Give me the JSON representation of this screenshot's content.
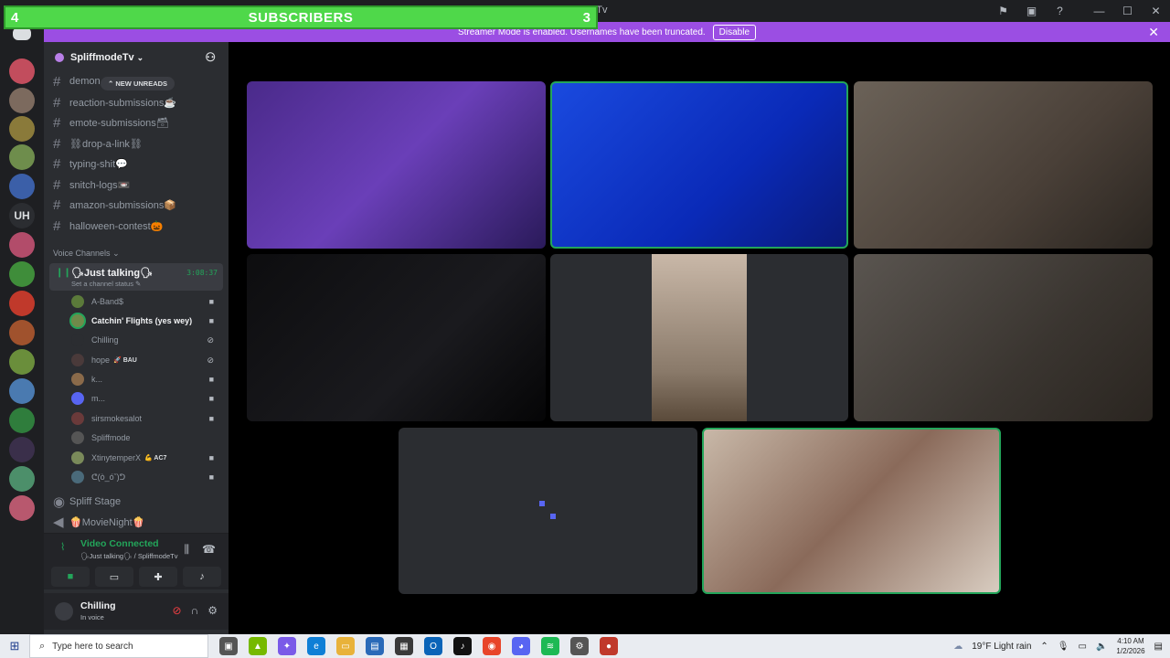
{
  "window": {
    "title": "deTv"
  },
  "overlay": {
    "left_count": "4",
    "label": "SUBSCRIBERS",
    "right_count": "3",
    "color": "#4fd84a"
  },
  "banner": {
    "text": "Streamer Mode is enabled. Usernames have been truncated.",
    "button": "Disable",
    "color": "#9b4ee3"
  },
  "rail": {
    "uh_label": "UH"
  },
  "server": {
    "name": "SpliffmodeTv"
  },
  "new_unreads": "NEW UNREADS",
  "channels": [
    {
      "name": "demon"
    },
    {
      "name": "reaction-submissions☕"
    },
    {
      "name": "emote-submissions🗃"
    },
    {
      "name": "⛓drop-a-link⛓"
    },
    {
      "name": "typing-shit💬"
    },
    {
      "name": "snitch-logs📼"
    },
    {
      "name": "amazon-submissions📦"
    },
    {
      "name": "halloween-contest🎃"
    }
  ],
  "voice_channels_header": "Voice Channels",
  "active_voice": {
    "name": "🗣Just talking🗣",
    "time": "3:08:37",
    "status": "Set a channel status ✎"
  },
  "members": [
    {
      "name": "A-Band$",
      "tag": "",
      "icon": "camera-icon"
    },
    {
      "name": "Catchin' Flights (yes wey)",
      "tag": "",
      "icon": "camera-icon"
    },
    {
      "name": "Chilling",
      "tag": "",
      "icon": "muted-icon"
    },
    {
      "name": "hope",
      "tag": "🚀 BAU",
      "icon": "deafened-icon"
    },
    {
      "name": "k...",
      "tag": "",
      "icon": "camera-icon"
    },
    {
      "name": "m...",
      "tag": "",
      "icon": "camera-icon"
    },
    {
      "name": "sirsmokesalot",
      "tag": "",
      "icon": "camera-icon"
    },
    {
      "name": "Spliffmode",
      "tag": "",
      "icon": ""
    },
    {
      "name": "XtinytemperX",
      "tag": "💪 AC7",
      "icon": "camera-icon"
    },
    {
      "name": "ᕦ(ò_óˇ)ᕤ",
      "tag": "",
      "icon": "camera-icon"
    }
  ],
  "other_voice": [
    {
      "name": "Spliff Stage"
    },
    {
      "name": "🍿MovieNight🍿"
    }
  ],
  "voice_panel": {
    "title": "Video Connected",
    "subtitle": "🗣Just talking🗣 / SpliffmodeTv"
  },
  "user": {
    "name": "Chilling",
    "status": "In voice"
  },
  "taskbar": {
    "search_placeholder": "Type here to search",
    "weather": "19°F  Light rain",
    "time": "4:10 AM",
    "date": "1/2/2026"
  }
}
